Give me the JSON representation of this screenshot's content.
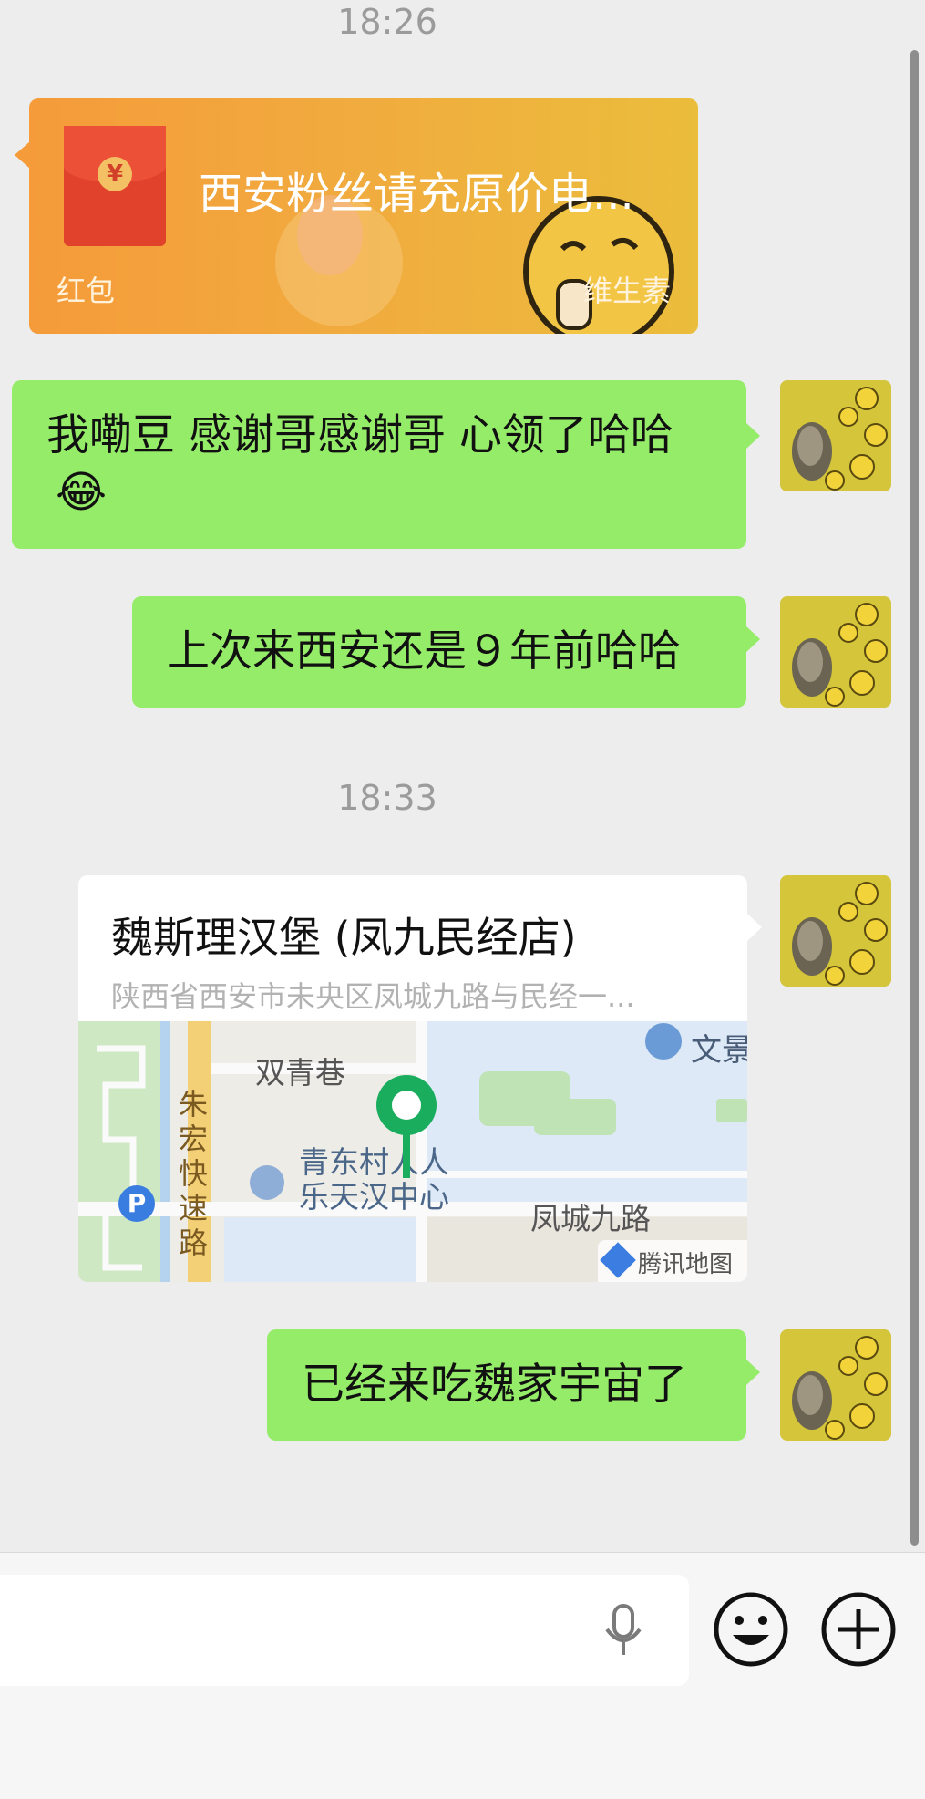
{
  "chat": {
    "timestamp_1": "18:26",
    "red_packet": {
      "title": "西安粉丝请充原价电...",
      "label": "红包",
      "brand": "维生素",
      "currency_symbol": "¥"
    },
    "message_1": "我嘞豆 感谢哥感谢哥 心领了哈哈",
    "message_1_emoji": "😂",
    "message_2": "上次来西安还是９年前哈哈",
    "timestamp_2": "18:33",
    "location": {
      "name": "魏斯理汉堡 (凤九民经店)",
      "address": "陕西省西安市未央区凤城九路与民经一...",
      "map_labels": {
        "street_1": "双青巷",
        "street_vertical": "朱宏快速路",
        "poi_1": "文景",
        "poi_2_line1": "青东村人人",
        "poi_2_line2": "乐天汉中心",
        "street_2": "凤城九路",
        "parking": "P",
        "provider": "腾讯地图"
      }
    },
    "message_3": "已经来吃魏家宇宙了"
  },
  "input_bar": {
    "input_value": "",
    "voice_icon": "microphone-icon",
    "emoji_icon": "smiley-face-icon",
    "more_icon": "plus-circle-icon"
  },
  "colors": {
    "background": "#ededed",
    "sent_bubble": "#95ec69",
    "red_packet": "#f59b3a",
    "map_pin": "#1aad5e"
  }
}
